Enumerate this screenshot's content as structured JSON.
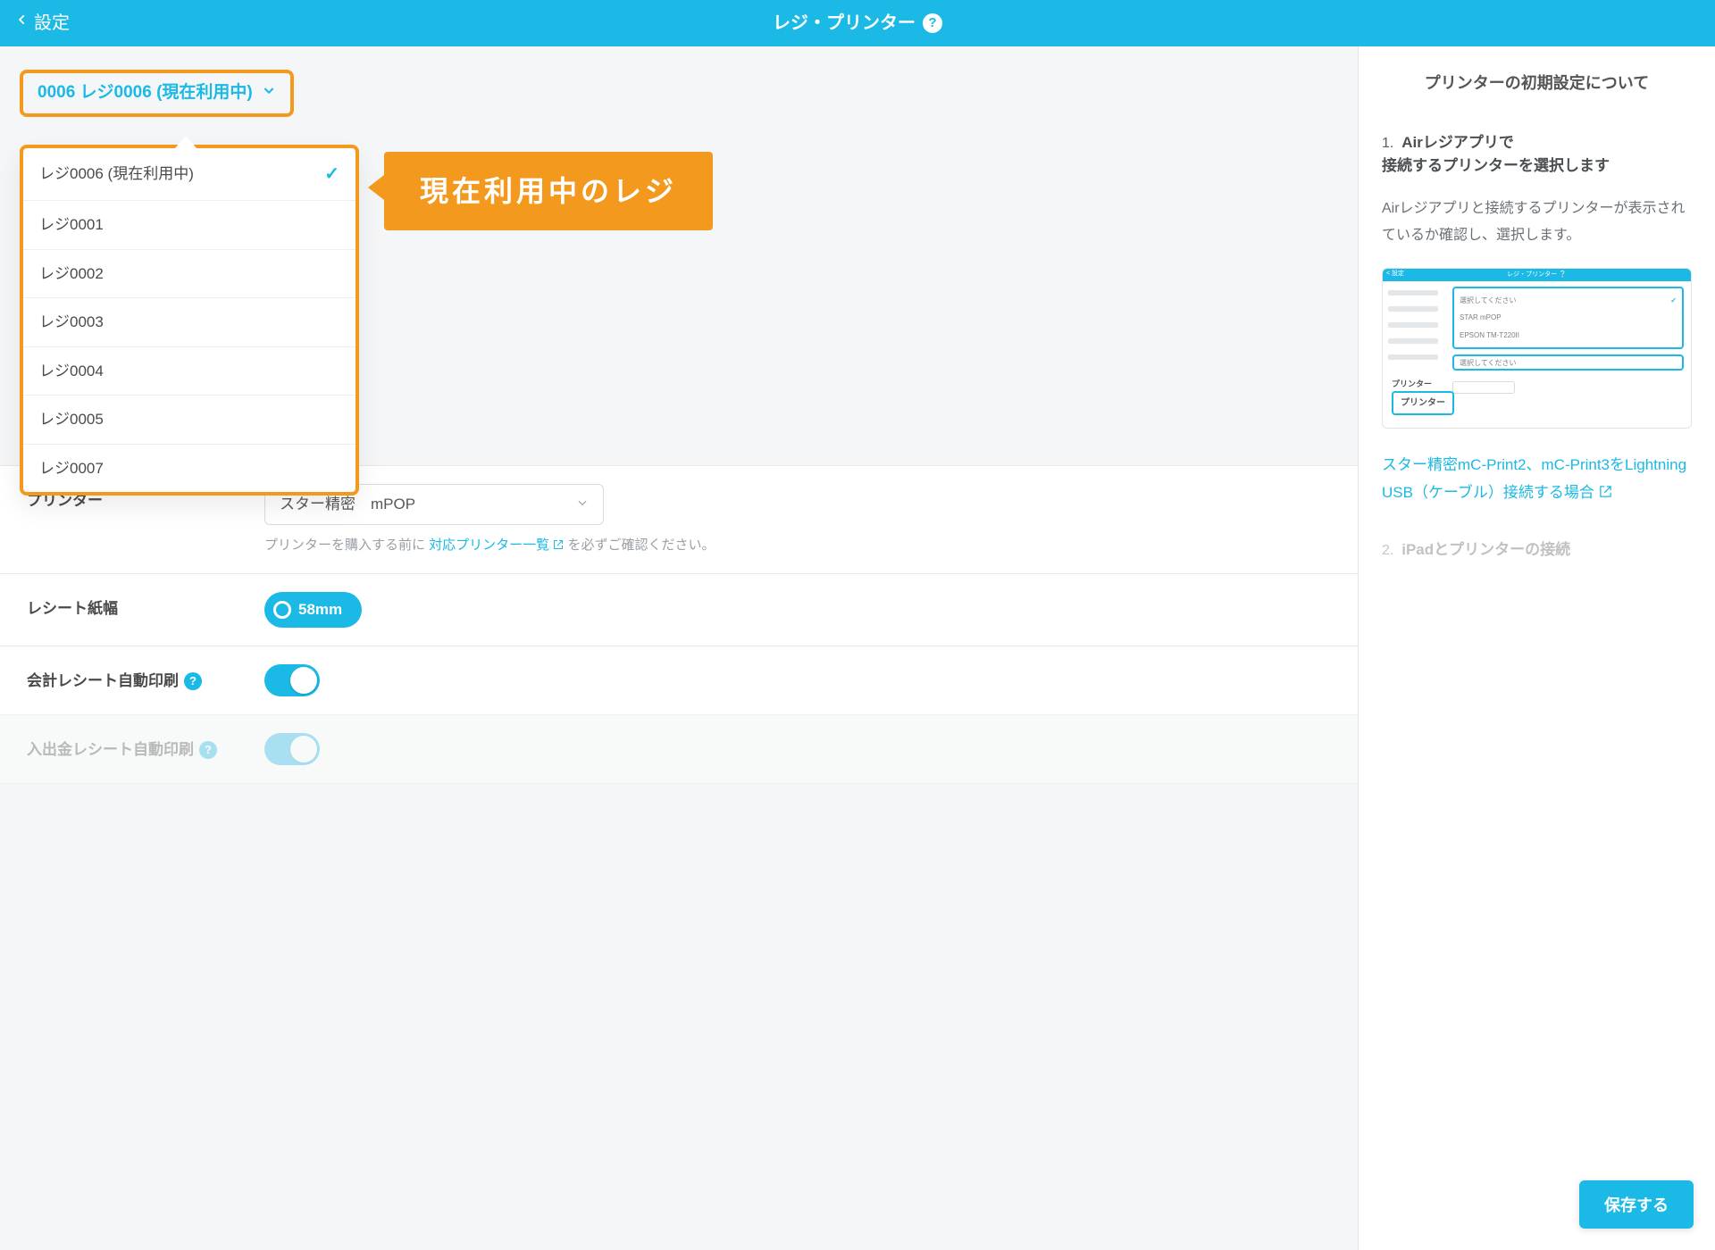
{
  "topbar": {
    "back_label": "設定",
    "title": "レジ・プリンター"
  },
  "selector": {
    "current_label": "0006  レジ0006 (現在利用中)",
    "options": [
      {
        "label": "レジ0006 (現在利用中)",
        "selected": true
      },
      {
        "label": "レジ0001",
        "selected": false
      },
      {
        "label": "レジ0002",
        "selected": false
      },
      {
        "label": "レジ0003",
        "selected": false
      },
      {
        "label": "レジ0004",
        "selected": false
      },
      {
        "label": "レジ0005",
        "selected": false
      },
      {
        "label": "レジ0007",
        "selected": false
      }
    ]
  },
  "callout": "現在利用中のレジ",
  "rows": {
    "printer": {
      "label": "プリンター",
      "value": "スター精密　mPOP",
      "hint_before": "プリンターを購入する前に ",
      "hint_link": "対応プリンター一覧",
      "hint_after": " を必ずご確認ください。"
    },
    "paper": {
      "label": "レシート紙幅",
      "value": "58mm"
    },
    "auto_print": {
      "label": "会計レシート自動印刷",
      "on": true
    },
    "cash_print": {
      "label": "入出金レシート自動印刷",
      "on": true
    }
  },
  "side": {
    "heading": "プリンターの初期設定について",
    "step1_title": "Airレジアプリで\n接続するプリンターを選択します",
    "step1_body": "Airレジアプリと接続するプリンターが表示されているか確認し、選択します。",
    "thumb": {
      "bar_title": "レジ・プリンター ❔",
      "back": "< 設定",
      "opt_placeholder": "選択してください",
      "opt1": "STAR mPOP",
      "opt2": "EPSON TM-T220II",
      "sel2": "選択してください",
      "printer_label": "プリンター",
      "tag": "プリンター"
    },
    "link": "スター精密mC-Print2、mC-Print3をLightning USB（ケーブル）接続する場合",
    "step2_title": "iPadとプリンターの接続"
  },
  "save_label": "保存する"
}
